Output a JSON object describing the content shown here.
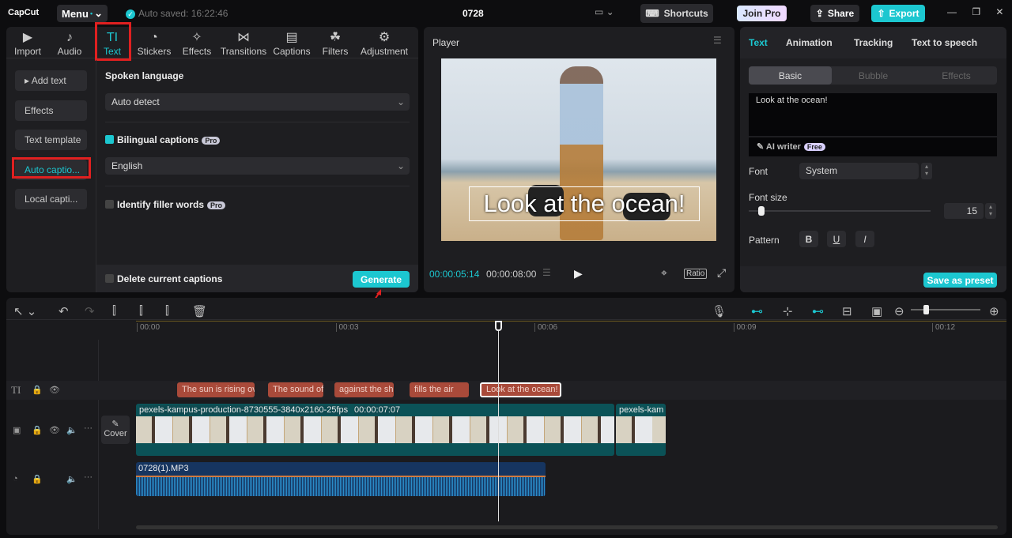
{
  "topbar": {
    "logo": "CapCut",
    "menu": "Menu",
    "autosave": "Auto saved: 16:22:46",
    "title": "0728",
    "shortcuts": "Shortcuts",
    "join_pro": "Join Pro",
    "share": "Share",
    "export": "Export"
  },
  "media_tabs": [
    {
      "label": "Import",
      "icon": "▶"
    },
    {
      "label": "Audio",
      "icon": "♪"
    },
    {
      "label": "Text",
      "icon": "TI"
    },
    {
      "label": "Stickers",
      "icon": "◔"
    },
    {
      "label": "Effects",
      "icon": "✧"
    },
    {
      "label": "Transitions",
      "icon": "⋈"
    },
    {
      "label": "Captions",
      "icon": "▤"
    },
    {
      "label": "Filters",
      "icon": "☘"
    },
    {
      "label": "Adjustment",
      "icon": "⚙"
    }
  ],
  "text_sidebar": [
    "▸ Add text",
    "Effects",
    "Text template",
    "Auto captio...",
    "Local capti..."
  ],
  "captions": {
    "spoken_language_label": "Spoken language",
    "spoken_language": "Auto detect",
    "bilingual": "Bilingual captions",
    "pro": "Pro",
    "bilingual_language": "English",
    "filler": "Identify filler words",
    "delete_current": "Delete current captions",
    "generate": "Generate"
  },
  "player": {
    "title": "Player",
    "overlay_text": "Look at the ocean!",
    "current_time": "00:00:05:14",
    "total_time": "00:00:08:00",
    "ratio": "Ratio"
  },
  "inspector": {
    "tabs": [
      "Text",
      "Animation",
      "Tracking",
      "Text to speech"
    ],
    "subtabs": [
      "Basic",
      "Bubble",
      "Effects"
    ],
    "text_value": "Look at the ocean!",
    "ai_writer": "AI writer",
    "free": "Free",
    "font_label": "Font",
    "font_value": "System",
    "font_size_label": "Font size",
    "font_size": "15",
    "font_size_fraction": 0.05,
    "pattern_label": "Pattern",
    "save_preset": "Save as preset"
  },
  "timeline": {
    "ticks": [
      "00:00",
      "00:03",
      "00:06",
      "00:09",
      "00:12"
    ],
    "captions": [
      "The sun is rising ov",
      "The sound of",
      "against the sh",
      "fills the air",
      "Look at the ocean!"
    ],
    "video_clip": "pexels-kampus-production-8730555-3840x2160-25fps",
    "video_duration": "00:00:07:07",
    "video_clip2": "pexels-kam",
    "cover": "Cover",
    "audio_clip": "0728(1).MP3"
  },
  "colors": {
    "accent": "#1cc7d0",
    "highlight": "#e02020"
  }
}
